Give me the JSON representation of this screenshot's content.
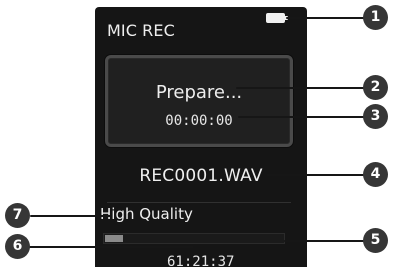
{
  "screen": {
    "title": "MIC REC",
    "battery_icon": "battery-full-icon",
    "status": "Prepare...",
    "elapsed_time": "00:00:00",
    "filename": "REC0001.WAV",
    "quality": "High Quality",
    "progress": 0.1,
    "remaining_time": "61:21:37"
  },
  "callouts": {
    "one": "1",
    "two": "2",
    "three": "3",
    "four": "4",
    "five": "5",
    "six": "6",
    "seven": "7"
  },
  "colors": {
    "screen_background": "#151515",
    "text": "#eeeeee",
    "box_border": "#4a4a4a",
    "progress_fill": "#8a8a8a",
    "callout_marker": "#363636"
  }
}
